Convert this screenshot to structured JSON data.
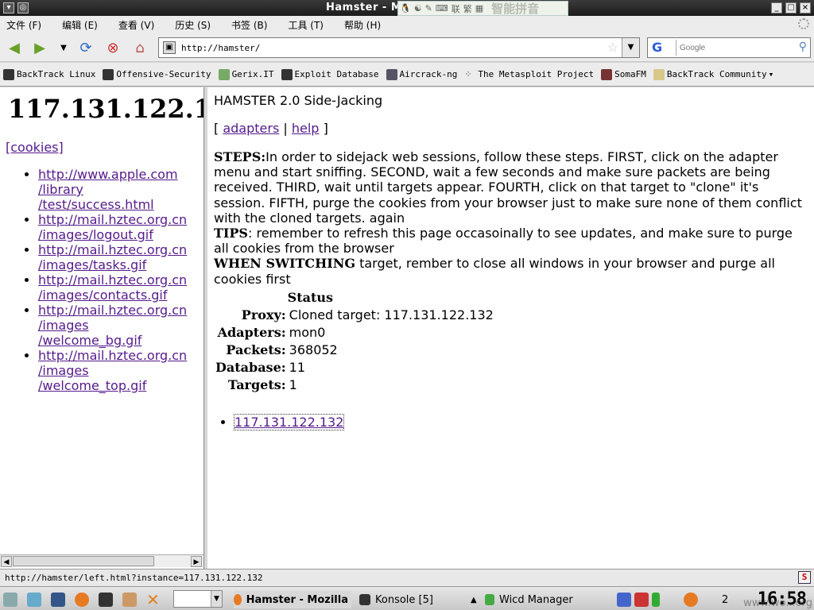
{
  "window": {
    "title": "Hamster - M",
    "ime_items": [
      "联",
      "繁"
    ],
    "ime_brand": "智能拼音"
  },
  "menu": [
    "文件 (F)",
    "编辑 (E)",
    "查看 (V)",
    "历史 (S)",
    "书签 (B)",
    "工具 (T)",
    "帮助 (H)"
  ],
  "navigation": {
    "url": "http://hamster/",
    "search_placeholder": "Google",
    "search_engine_icon": "G"
  },
  "bookmarks": [
    "BackTrack Linux",
    "Offensive-Security",
    "Gerix.IT",
    "Exploit Database",
    "Aircrack-ng",
    "The Metasploit Project",
    "SomaFM",
    "BackTrack Community"
  ],
  "left_frame": {
    "heading": "117.131.122.1",
    "cookies_link": "[cookies]",
    "urls": [
      [
        "http://www.apple.com",
        "/library",
        "/test/success.html"
      ],
      [
        "http://mail.hztec.org.cn",
        "/images/logout.gif"
      ],
      [
        "http://mail.hztec.org.cn",
        "/images/tasks.gif"
      ],
      [
        "http://mail.hztec.org.cn",
        "/images/contacts.gif"
      ],
      [
        "http://mail.hztec.org.cn",
        "/images",
        "/welcome_bg.gif"
      ],
      [
        "http://mail.hztec.org.cn",
        "/images",
        "/welcome_top.gif"
      ]
    ]
  },
  "right_frame": {
    "heading": "HAMSTER 2.0 Side-Jacking",
    "bracket_open": "[",
    "separator": "|",
    "bracket_close": "]",
    "adapters_link": "adapters",
    "help_link": "help",
    "steps_label": "STEPS:",
    "steps_text": "In order to sidejack web sessions, follow these steps. FIRST, click on the adapter menu and start sniffing. SECOND, wait a few seconds and make sure packets are being received. THIRD, wait until targets appear. FOURTH, click on that target to \"clone\" it's session. FIFTH, purge the cookies from your browser just to make sure none of them conflict with the cloned targets. again",
    "tips_label": "TIPS",
    "tips_text": ": remember to refresh this page occasoinally to see updates, and make sure to purge all cookies from the browser",
    "switch_label": "WHEN SWITCHING",
    "switch_text": " target, rember to close all windows in your browser and purge all cookies first",
    "status_header": "Status",
    "status": {
      "proxy_label": "Proxy:",
      "proxy_value": "Cloned target: 117.131.122.132",
      "adapters_label": "Adapters:",
      "adapters_value": "mon0",
      "packets_label": "Packets:",
      "packets_value": "368052",
      "database_label": "Database:",
      "database_value": "11",
      "targets_label": "Targets:",
      "targets_value": "1"
    },
    "targets": [
      "117.131.122.132"
    ]
  },
  "statusbar": {
    "text": "http://hamster/left.html?instance=117.131.122.132",
    "icon": "S"
  },
  "taskbar": {
    "tasks": [
      "Hamster - Mozilla",
      "Konsole [5]",
      "Wicd Manager"
    ],
    "workspace": "2",
    "clock": "16:58",
    "watermark": "www.wo...org"
  }
}
